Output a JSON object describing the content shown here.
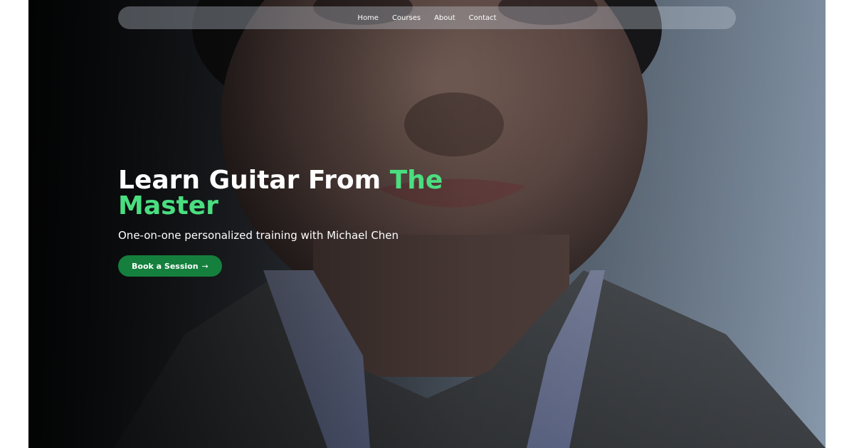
{
  "nav": {
    "items": [
      {
        "label": "Home"
      },
      {
        "label": "Courses"
      },
      {
        "label": "About"
      },
      {
        "label": "Contact"
      }
    ]
  },
  "hero": {
    "headline_main": "Learn Guitar From ",
    "headline_accent": "The Master",
    "subtitle": "One-on-one personalized training with Michael Chen",
    "cta_label": "Book a Session",
    "cta_icon": "arrow-right-icon",
    "accent_color": "#4ade80",
    "cta_color": "#15803d"
  }
}
